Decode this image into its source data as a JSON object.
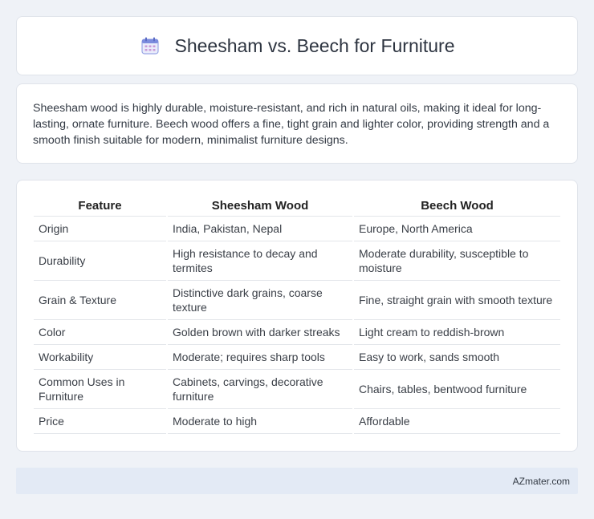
{
  "header": {
    "title": "Sheesham vs. Beech for Furniture",
    "icon": "calendar-icon"
  },
  "intro": {
    "text": "Sheesham wood is highly durable, moisture-resistant, and rich in natural oils, making it ideal for long-lasting, ornate furniture. Beech wood offers a fine, tight grain and lighter color, providing strength and a smooth finish suitable for modern, minimalist furniture designs."
  },
  "table": {
    "headers": [
      "Feature",
      "Sheesham Wood",
      "Beech Wood"
    ],
    "rows": [
      [
        "Origin",
        "India, Pakistan, Nepal",
        "Europe, North America"
      ],
      [
        "Durability",
        "High resistance to decay and termites",
        "Moderate durability, susceptible to moisture"
      ],
      [
        "Grain & Texture",
        "Distinctive dark grains, coarse texture",
        "Fine, straight grain with smooth texture"
      ],
      [
        "Color",
        "Golden brown with darker streaks",
        "Light cream to reddish-brown"
      ],
      [
        "Workability",
        "Moderate; requires sharp tools",
        "Easy to work, sands smooth"
      ],
      [
        "Common Uses in Furniture",
        "Cabinets, carvings, decorative furniture",
        "Chairs, tables, bentwood furniture"
      ],
      [
        "Price",
        "Moderate to high",
        "Affordable"
      ]
    ]
  },
  "footer": {
    "text": "AZmater.com"
  },
  "colors": {
    "background": "#eff2f7",
    "card": "#ffffff",
    "footer": "#e3eaf5",
    "icon_accent": "#7b8cde"
  }
}
